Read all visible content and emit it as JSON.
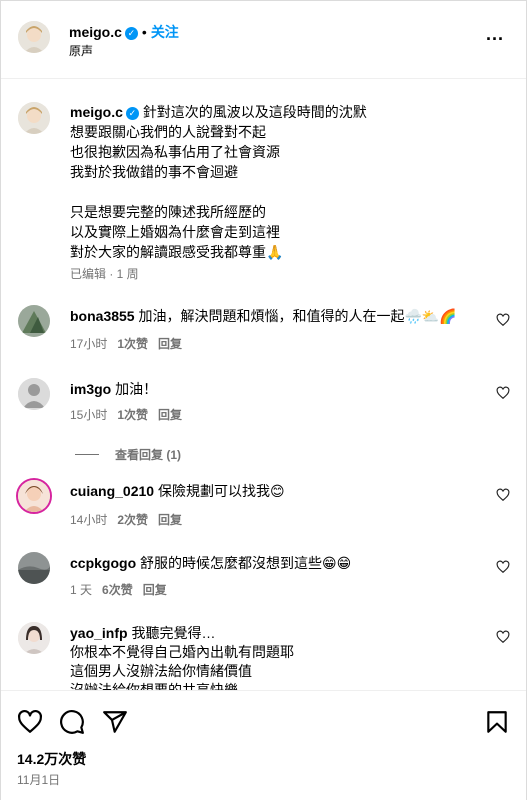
{
  "header": {
    "username": "meigo.c",
    "follow_label": "关注",
    "subtitle": "原声",
    "more_label": "..."
  },
  "caption": {
    "username": "meigo.c",
    "text": "針對這次的風波以及這段時間的沈默\n想要跟關心我們的人說聲對不起\n也很抱歉因為私事佔用了社會資源\n我對於我做錯的事不會迴避\n\n只是想要完整的陳述我所經歷的\n以及實際上婚姻為什麼會走到這裡\n對於大家的解讀跟感受我都尊重🙏",
    "meta": "已编辑 · 1 周"
  },
  "comments": [
    {
      "username": "bona3855",
      "text": "加油，解決問題和煩惱，和值得的人在一起🌧️⛅🌈",
      "time": "17小时",
      "likes": "1次赞",
      "reply": "回复"
    },
    {
      "username": "im3go",
      "text": "加油！",
      "time": "15小时",
      "likes": "1次赞",
      "reply": "回复"
    },
    {
      "username": "cuiang_0210",
      "text": "保險規劃可以找我😊",
      "time": "14小时",
      "likes": "2次赞",
      "reply": "回复"
    },
    {
      "username": "ccpkgogo",
      "text": "舒服的時候怎麼都沒想到這些😁😁",
      "time": "1 天",
      "likes": "6次赞",
      "reply": "回复"
    },
    {
      "username": "yao_infp",
      "text": "我聽完覺得…\n你根本不覺得自己婚內出軌有問題耶\n這個男人沒辦法給你情緒價值\n沒辦法給你想要的共享快樂"
    }
  ],
  "view_replies": "查看回复 (1)",
  "footer": {
    "likes": "14.2万次赞",
    "date": "11月1日"
  },
  "icons": [
    "more-icon",
    "verified-icon",
    "heart-icon",
    "comment-icon",
    "share-icon",
    "bookmark-icon"
  ],
  "colors": {
    "accent": "#0095f6",
    "muted": "#737373",
    "border": "#dbdbdb"
  }
}
